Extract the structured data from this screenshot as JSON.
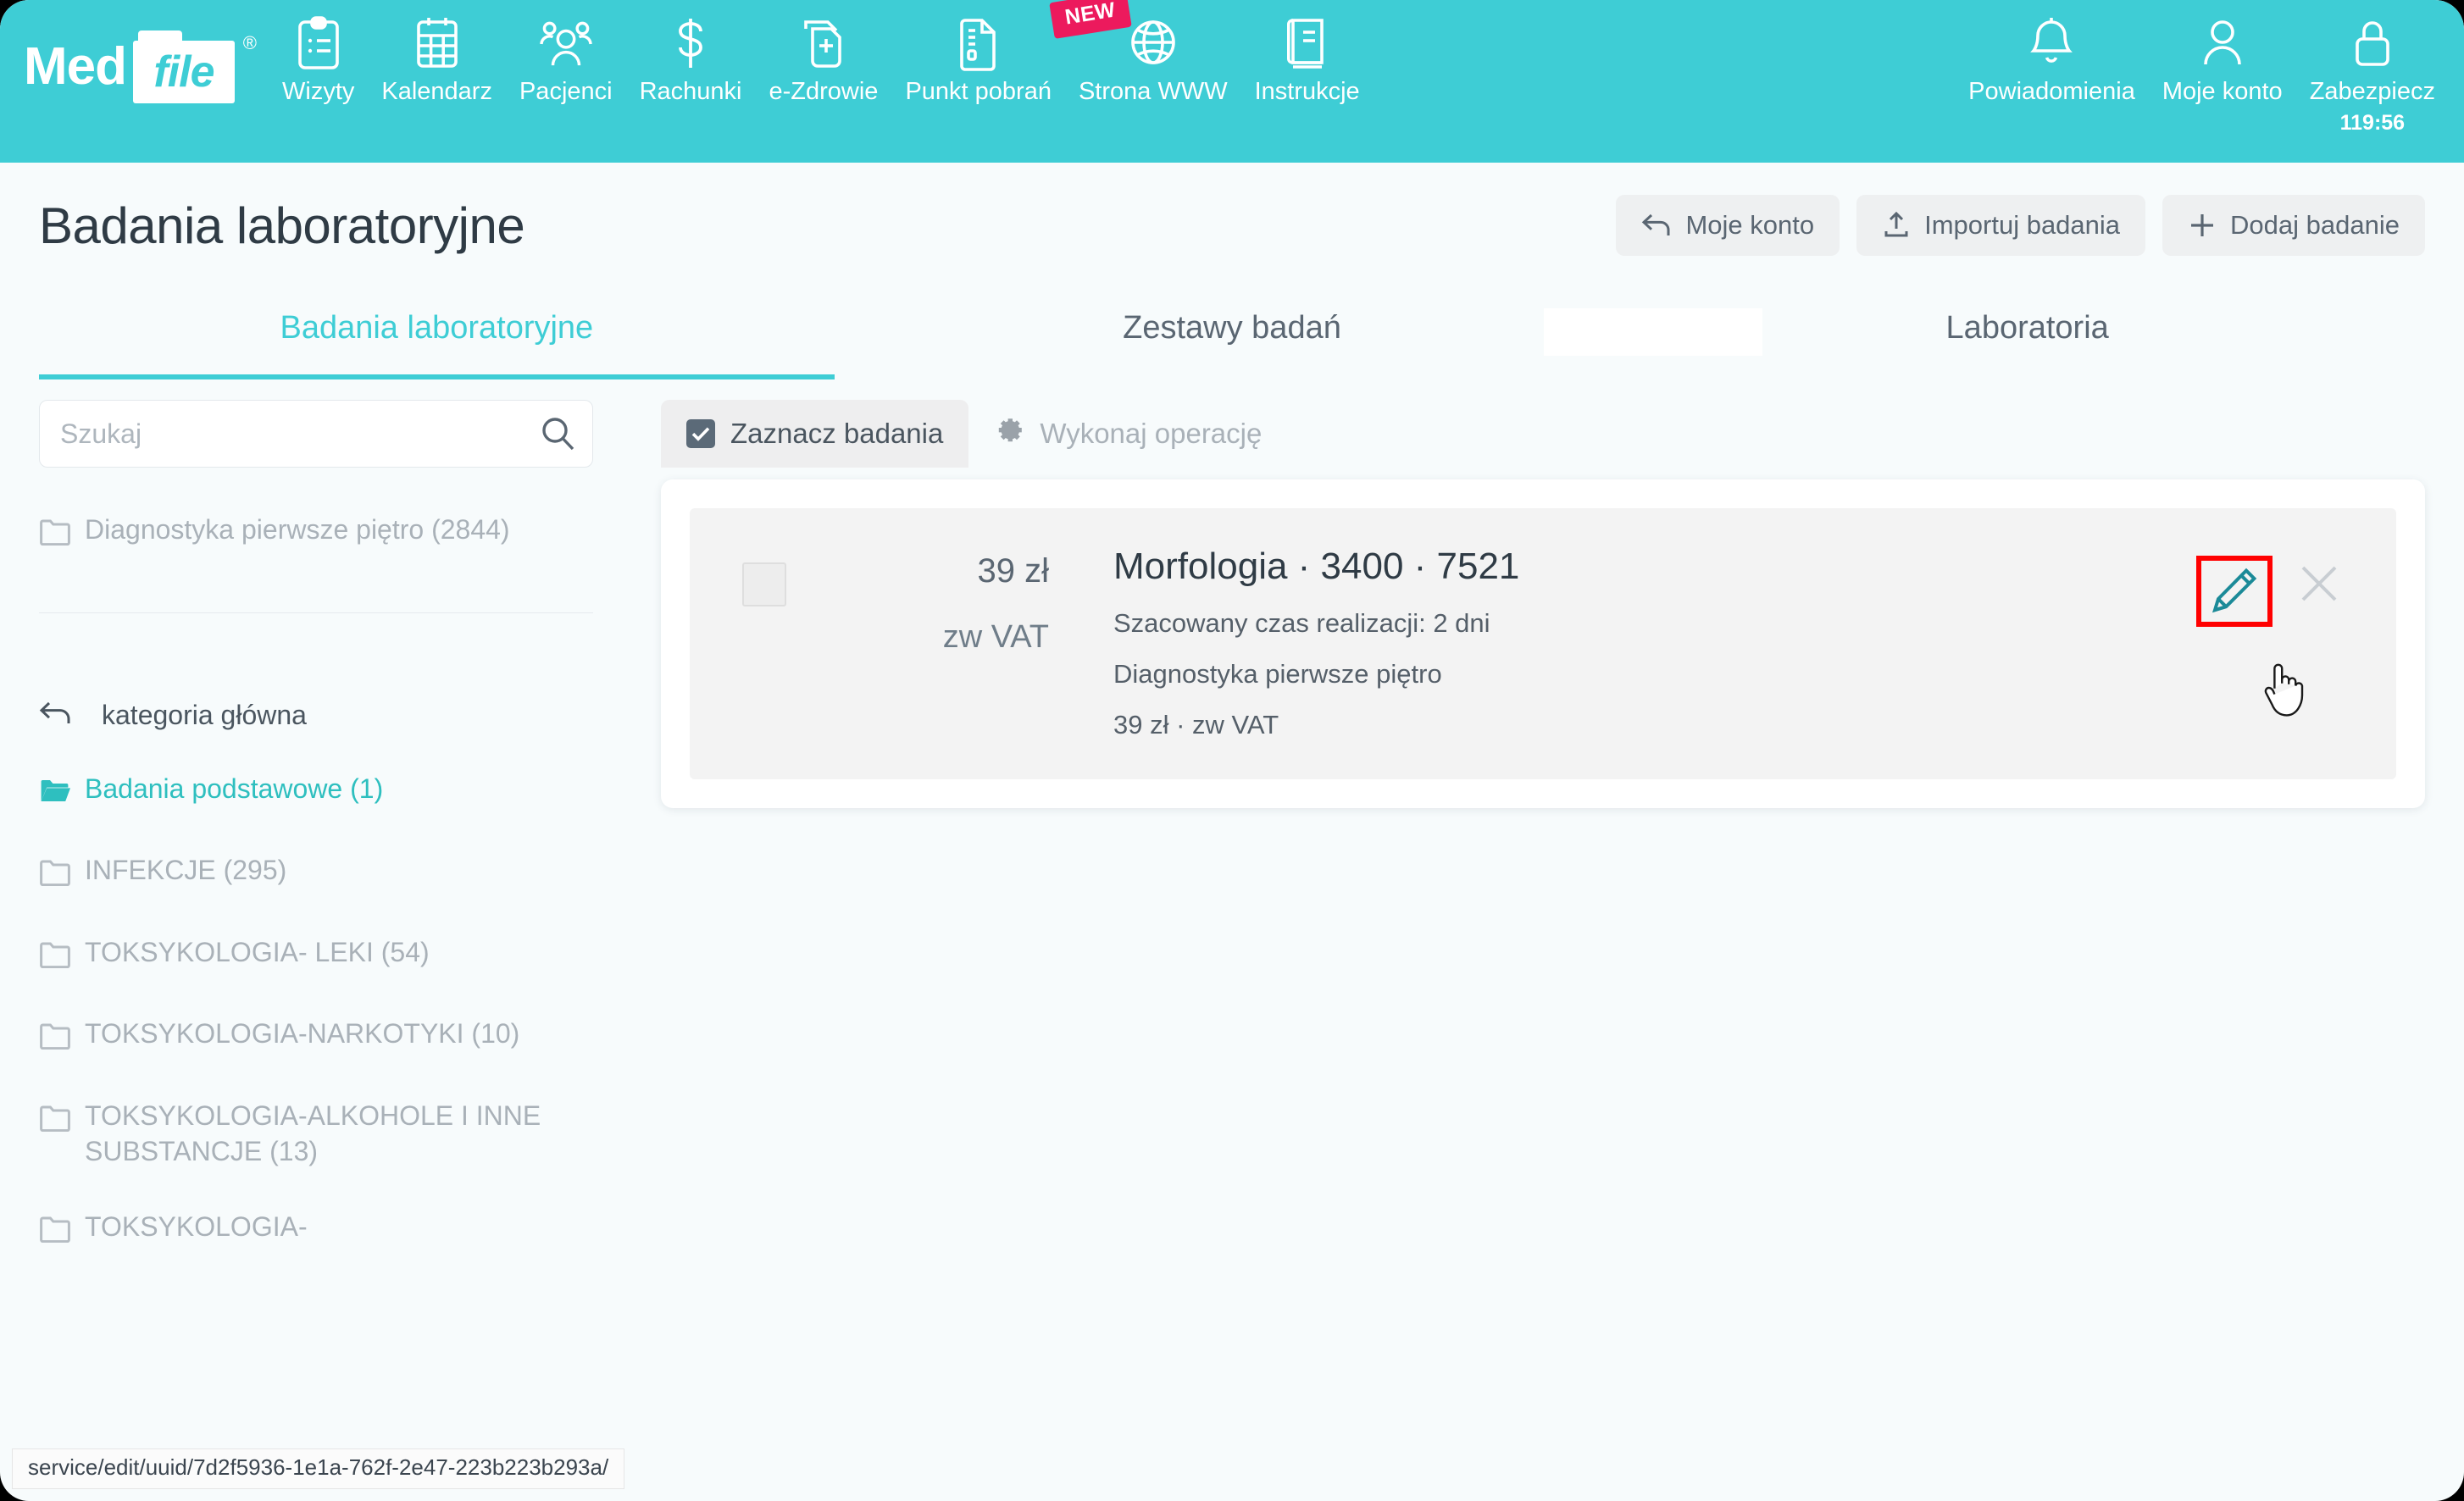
{
  "brand": {
    "name_part1": "Med",
    "name_part2": "file",
    "registered": "®"
  },
  "topnav": {
    "items": [
      {
        "label": "Wizyty",
        "icon": "clipboard-icon"
      },
      {
        "label": "Kalendarz",
        "icon": "calendar-icon"
      },
      {
        "label": "Pacjenci",
        "icon": "people-icon"
      },
      {
        "label": "Rachunki",
        "icon": "dollar-icon"
      },
      {
        "label": "e-Zdrowie",
        "icon": "document-plus-icon"
      },
      {
        "label": "Punkt pobrań",
        "icon": "document-lines-icon"
      },
      {
        "label": "Strona WWW",
        "icon": "globe-icon",
        "badge": "NEW"
      },
      {
        "label": "Instrukcje",
        "icon": "book-icon"
      }
    ],
    "right_items": [
      {
        "label": "Powiadomienia",
        "icon": "bell-icon"
      },
      {
        "label": "Moje konto",
        "icon": "person-icon"
      },
      {
        "label": "Zabezpiecz",
        "icon": "lock-icon",
        "timer": "119:56"
      }
    ]
  },
  "page": {
    "title": "Badania laboratoryjne",
    "actions": [
      {
        "label": "Moje konto",
        "icon": "back-arrow-icon"
      },
      {
        "label": "Importuj badania",
        "icon": "upload-icon"
      },
      {
        "label": "Dodaj badanie",
        "icon": "plus-icon"
      }
    ]
  },
  "tabs": [
    {
      "label": "Badania laboratoryjne",
      "active": true
    },
    {
      "label": "Zestawy badań",
      "active": false
    },
    {
      "label": "Laboratoria",
      "active": false
    }
  ],
  "sidebar": {
    "search_placeholder": "Szukaj",
    "search_value": "",
    "current_folder": {
      "label": "Diagnostyka pierwsze piętro (2844)",
      "icon": "folder-closed-icon"
    },
    "back_label": "kategoria główna",
    "categories": [
      {
        "label": "Badania podstawowe (1)",
        "icon": "folder-open-icon",
        "state": "teal"
      },
      {
        "label": "INFEKCJE (295)",
        "icon": "folder-closed-icon",
        "state": "gray"
      },
      {
        "label": "TOKSYKOLOGIA- LEKI (54)",
        "icon": "folder-closed-icon",
        "state": "gray"
      },
      {
        "label": "TOKSYKOLOGIA-NARKOTYKI (10)",
        "icon": "folder-closed-icon",
        "state": "gray"
      },
      {
        "label": "TOKSYKOLOGIA-ALKOHOLE I INNE SUBSTANCJE (13)",
        "icon": "folder-closed-icon",
        "state": "gray"
      },
      {
        "label": "TOKSYKOLOGIA-",
        "icon": "folder-closed-icon",
        "state": "gray"
      }
    ]
  },
  "toolbar": {
    "select_label": "Zaznacz badania",
    "operation_label": "Wykonaj operację"
  },
  "results": [
    {
      "price_amount": "39 zł",
      "price_vat": "zw VAT",
      "title": "Morfologia · 3400 · 7521",
      "line1": "Szacowany czas realizacji: 2 dni",
      "line2": "Diagnostyka pierwsze piętro",
      "line3": "39 zł · zw VAT",
      "edit_icon": "pencil-icon",
      "delete_icon": "close-x-icon"
    }
  ],
  "statusbar": {
    "url": "service/edit/uuid/7d2f5936-1e1a-762f-2e47-223b223b293a/"
  },
  "colors": {
    "brand_teal": "#3ecdd5",
    "badge_pink": "#ec1a5d",
    "highlight_red": "#ff0000"
  }
}
